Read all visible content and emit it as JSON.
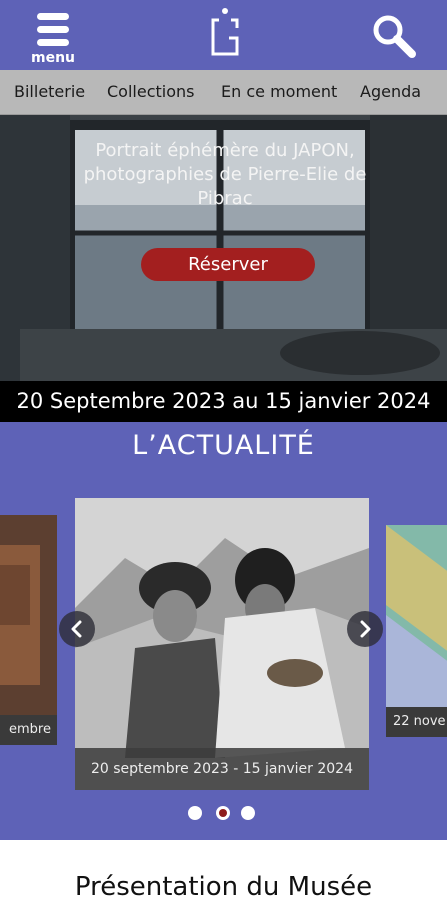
{
  "header": {
    "menu_label": "menu",
    "logo_icon": "museum-logo-icon",
    "search_icon": "search-icon",
    "background": "#5e62b7"
  },
  "nav": {
    "items": [
      {
        "label": "Billeterie"
      },
      {
        "label": "Collections"
      },
      {
        "label": "En ce moment"
      },
      {
        "label": "Agenda"
      }
    ]
  },
  "hero": {
    "title": "Portrait éphémère du JAPON, photographies de Pierre-Elie de Pibrac",
    "button_label": "Réserver",
    "dates": "20 Septembre 2023 au 15 janvier 2024",
    "button_color": "#a31f1f"
  },
  "news": {
    "title": "L’ACTUALITÉ",
    "cards": [
      {
        "caption": "embre"
      },
      {
        "caption": "20 septembre 2023 - 15 janvier 2024"
      },
      {
        "caption": "22 nove"
      }
    ],
    "prev_icon": "chevron-left-icon",
    "next_icon": "chevron-right-icon",
    "dots": [
      {
        "active": false
      },
      {
        "active": true
      },
      {
        "active": false
      }
    ]
  },
  "presentation": {
    "title": "Présentation du Musée"
  }
}
